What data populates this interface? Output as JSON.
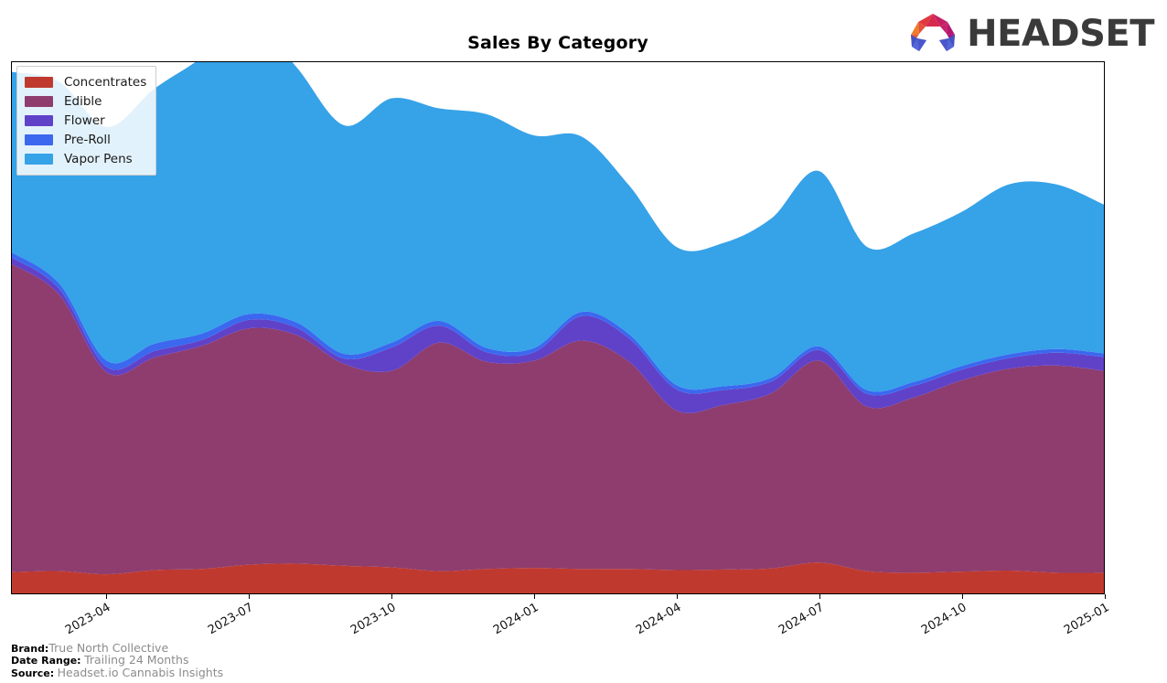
{
  "header": {
    "title": "Sales By Category",
    "logo_text": "HEADSET",
    "logo_icon": "headset-arch-logo"
  },
  "legend": {
    "position": "upper-left",
    "items": [
      {
        "label": "Concentrates",
        "color": "#c0392f"
      },
      {
        "label": "Edible",
        "color": "#8e3d6e"
      },
      {
        "label": "Flower",
        "color": "#6042c8"
      },
      {
        "label": "Pre-Roll",
        "color": "#3b68ef"
      },
      {
        "label": "Vapor Pens",
        "color": "#36a2e8"
      }
    ]
  },
  "footer": {
    "brand_key": "Brand:",
    "brand_value": "True North Collective",
    "date_range_key": "Date Range:",
    "date_range_value": "Trailing 24 Months",
    "source_key": "Source:",
    "source_value": "Headset.io Cannabis Insights"
  },
  "chart_data": {
    "type": "area",
    "stacked": true,
    "smoothing": "spline",
    "title": "Sales By Category",
    "xlabel": "",
    "ylabel": "",
    "grid": false,
    "legend_position": "upper left",
    "x": [
      "2023-02",
      "2023-03",
      "2023-04",
      "2023-05",
      "2023-06",
      "2023-07",
      "2023-08",
      "2023-09",
      "2023-10",
      "2023-11",
      "2023-12",
      "2024-01",
      "2024-02",
      "2024-03",
      "2024-04",
      "2024-05",
      "2024-06",
      "2024-07",
      "2024-08",
      "2024-09",
      "2024-10",
      "2024-11",
      "2024-12",
      "2025-01"
    ],
    "xtick_labels": [
      "2023-04",
      "2023-07",
      "2023-10",
      "2024-01",
      "2024-04",
      "2024-07",
      "2024-10",
      "2025-01"
    ],
    "xtick_rotation": -30,
    "ylim": [
      0,
      100
    ],
    "series": [
      {
        "name": "Concentrates",
        "color": "#c0392f",
        "values": [
          4.0,
          4.2,
          3.6,
          4.4,
          4.6,
          5.4,
          5.6,
          5.2,
          4.9,
          4.2,
          4.6,
          4.8,
          4.6,
          4.6,
          4.4,
          4.5,
          4.7,
          5.8,
          4.2,
          3.9,
          4.1,
          4.3,
          3.9,
          3.9
        ]
      },
      {
        "name": "Edible",
        "color": "#8e3d6e",
        "values": [
          58.0,
          52.0,
          38.0,
          40.0,
          42.0,
          44.5,
          43.0,
          38.0,
          37.0,
          43.0,
          39.0,
          39.0,
          43.0,
          39.0,
          30.0,
          31.0,
          33.0,
          38.0,
          31.0,
          33.0,
          36.0,
          38.0,
          39.0,
          38.0
        ]
      },
      {
        "name": "Flower",
        "color": "#6042c8",
        "values": [
          1.2,
          1.1,
          1.0,
          1.2,
          1.1,
          1.6,
          1.4,
          1.0,
          4.4,
          3.2,
          1.8,
          1.6,
          4.6,
          4.4,
          4.0,
          2.8,
          2.2,
          2.0,
          2.4,
          2.2,
          2.0,
          2.0,
          2.4,
          2.6
        ]
      },
      {
        "name": "Pre-Roll",
        "color": "#3b68ef",
        "values": [
          1.0,
          1.0,
          1.2,
          1.4,
          1.2,
          1.1,
          1.0,
          0.9,
          0.9,
          0.9,
          0.8,
          0.8,
          0.8,
          0.8,
          0.8,
          0.7,
          0.7,
          0.7,
          0.7,
          0.7,
          0.7,
          0.7,
          0.7,
          0.7
        ]
      },
      {
        "name": "Vapor Pens",
        "color": "#36a2e8",
        "values": [
          34.0,
          38.0,
          44.0,
          48.0,
          52.0,
          56.0,
          48.0,
          43.0,
          46.0,
          40.0,
          44.0,
          40.0,
          33.0,
          28.0,
          26.0,
          27.0,
          30.0,
          33.0,
          27.0,
          28.0,
          29.0,
          32.0,
          31.0,
          28.0
        ]
      }
    ]
  }
}
